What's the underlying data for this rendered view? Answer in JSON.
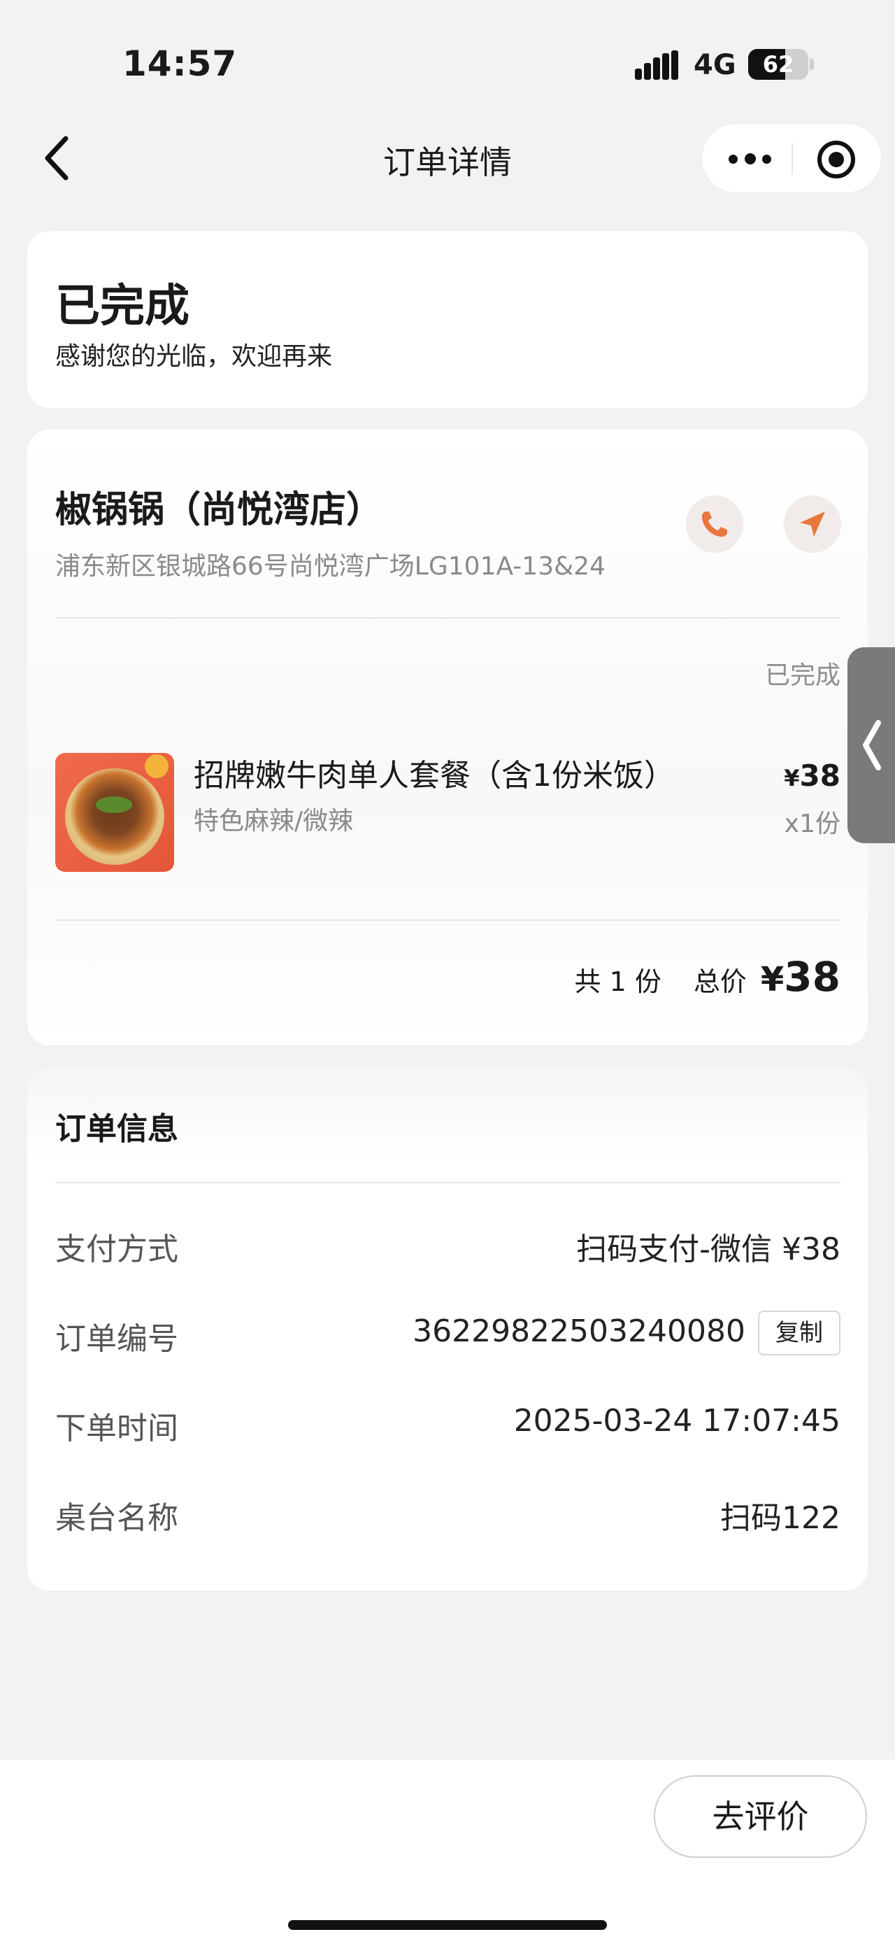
{
  "status_bar": {
    "time": "14:57",
    "network": "4G",
    "battery": "62",
    "battery_level": 0.62
  },
  "nav": {
    "title": "订单详情",
    "back_icon": "chevron-left-icon",
    "more_icon": "more-dots-icon",
    "close_icon": "target-close-icon"
  },
  "order_status": {
    "title": "已完成",
    "subtitle": "感谢您的光临，欢迎再来"
  },
  "store": {
    "name": "椒锅锅（尚悦湾店）",
    "address": "浦东新区银城路66号尚悦湾广场LG101A-13&24",
    "phone_icon": "phone-icon",
    "navigate_icon": "navigation-arrow-icon",
    "accent_color": "#e8763e"
  },
  "order_items": {
    "state": "已完成",
    "items": [
      {
        "name": "招牌嫩牛肉单人套餐（含1份米饭）",
        "spec": "特色麻辣/微辣",
        "currency": "¥",
        "price": "38",
        "qty": "x1份"
      }
    ],
    "summary": {
      "count": "共 1 份",
      "total_label": "总价",
      "currency": "¥",
      "total": "38"
    }
  },
  "order_info": {
    "title": "订单信息",
    "rows": [
      {
        "label": "支付方式",
        "value": "扫码支付-微信 ¥38"
      },
      {
        "label": "订单编号",
        "value": "362298225032400​80"
      },
      {
        "label": "下单时间",
        "value": "2025-03-24 17:07:45"
      },
      {
        "label": "桌台名称",
        "value": "扫码122"
      }
    ],
    "copy_label": "复制"
  },
  "bottom": {
    "review_label": "去评价"
  }
}
